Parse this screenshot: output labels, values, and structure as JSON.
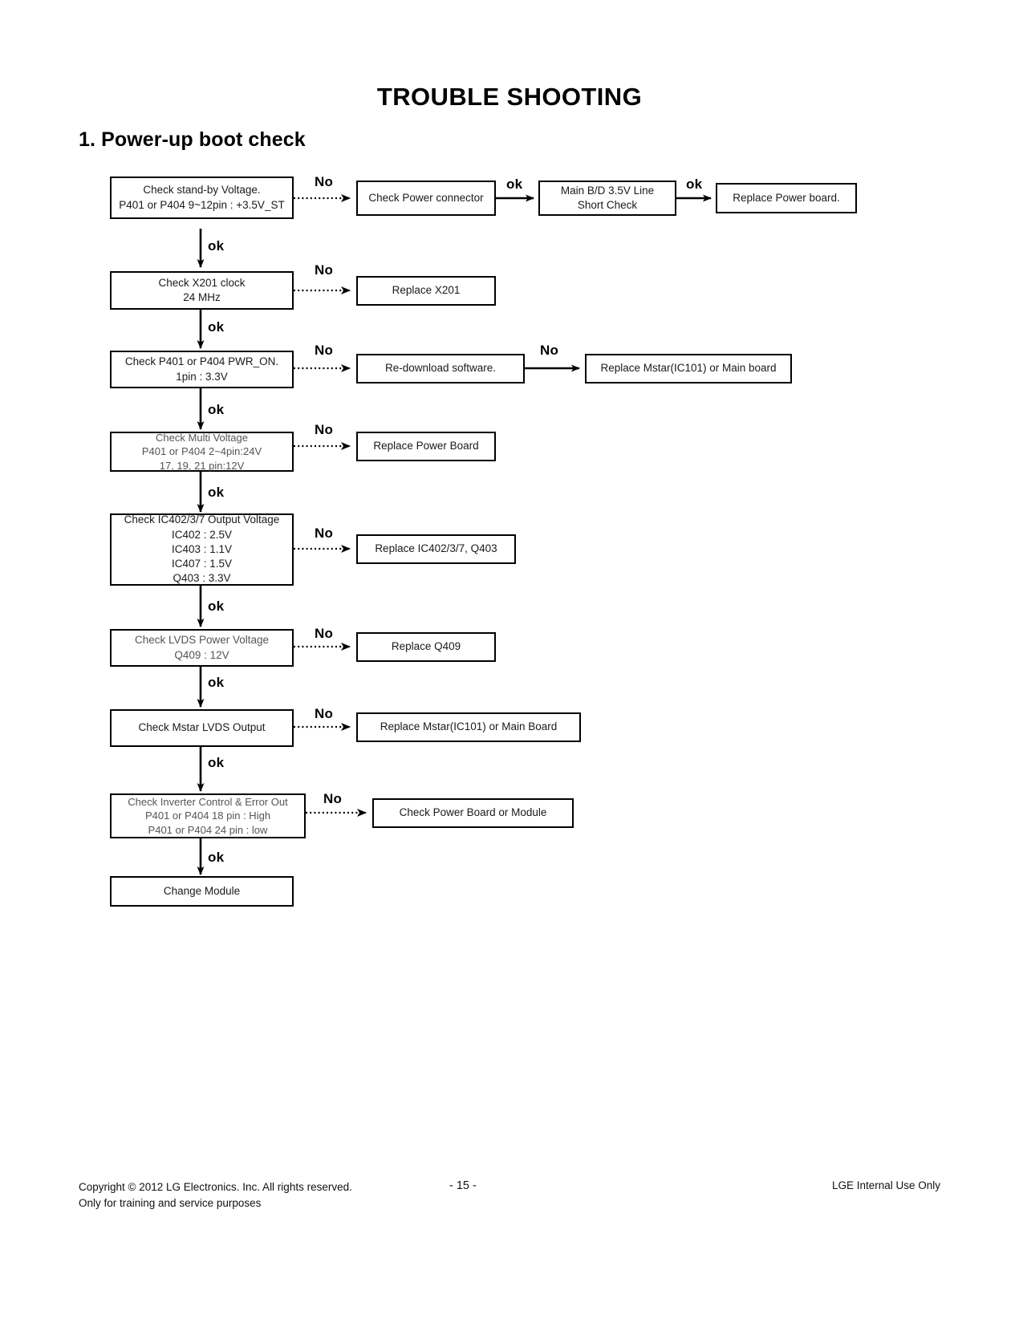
{
  "document": {
    "title": "TROUBLE SHOOTING",
    "section_title": "1. Power-up boot check"
  },
  "flowchart": {
    "nodes": [
      {
        "id": "check-standby-voltage",
        "lines": [
          "Check stand-by Voltage.",
          "P401 or P404 9~12pin : +3.5V_ST"
        ]
      },
      {
        "id": "check-power-connector",
        "lines": [
          "Check Power connector"
        ]
      },
      {
        "id": "main-bd-short-check",
        "lines": [
          "Main B/D 3.5V Line",
          "Short Check"
        ]
      },
      {
        "id": "replace-power-board-1",
        "lines": [
          "Replace Power board."
        ]
      },
      {
        "id": "check-x201-clock",
        "lines": [
          "Check X201 clock",
          "24 MHz"
        ]
      },
      {
        "id": "replace-x201",
        "lines": [
          "Replace X201"
        ]
      },
      {
        "id": "check-pwr-on",
        "lines": [
          "Check P401 or P404 PWR_ON.",
          "1pin : 3.3V"
        ]
      },
      {
        "id": "re-download-software",
        "lines": [
          "Re-download software."
        ]
      },
      {
        "id": "replace-mstar-main-board-1",
        "lines": [
          "Replace Mstar(IC101) or Main board"
        ]
      },
      {
        "id": "check-multi-voltage",
        "lines": [
          "Check Multi Voltage",
          "P401 or P404 2~4pin:24V",
          "17, 19, 21 pin:12V"
        ]
      },
      {
        "id": "replace-power-board-2",
        "lines": [
          "Replace Power Board"
        ]
      },
      {
        "id": "check-ic-output-voltage",
        "lines": [
          "Check IC402/3/7 Output Voltage",
          "IC402 : 2.5V",
          "IC403 : 1.1V",
          "IC407 : 1.5V",
          "Q403 : 3.3V"
        ]
      },
      {
        "id": "replace-ic-q403",
        "lines": [
          "Replace IC402/3/7, Q403"
        ]
      },
      {
        "id": "check-lvds-power-voltage",
        "lines": [
          "Check LVDS Power Voltage",
          "Q409 : 12V"
        ]
      },
      {
        "id": "replace-q409",
        "lines": [
          "Replace Q409"
        ]
      },
      {
        "id": "check-mstar-lvds-output",
        "lines": [
          "Check Mstar LVDS Output"
        ]
      },
      {
        "id": "replace-mstar-main-board-2",
        "lines": [
          "Replace Mstar(IC101) or Main Board"
        ]
      },
      {
        "id": "check-inverter-control",
        "lines": [
          "Check Inverter Control & Error Out",
          "P401 or P404 18 pin : High",
          "P401 or P404 24 pin : low"
        ]
      },
      {
        "id": "check-power-board-or-module",
        "lines": [
          "Check Power Board or Module"
        ]
      },
      {
        "id": "change-module",
        "lines": [
          "Change Module"
        ]
      }
    ],
    "edge_labels": {
      "no": "No",
      "ok": "ok"
    }
  },
  "footer": {
    "copyright_line1": "Copyright  © 2012  LG Electronics. Inc. All rights reserved.",
    "copyright_line2": "Only for training and service purposes",
    "page_number": "- 15 -",
    "notice": "LGE Internal Use Only"
  }
}
